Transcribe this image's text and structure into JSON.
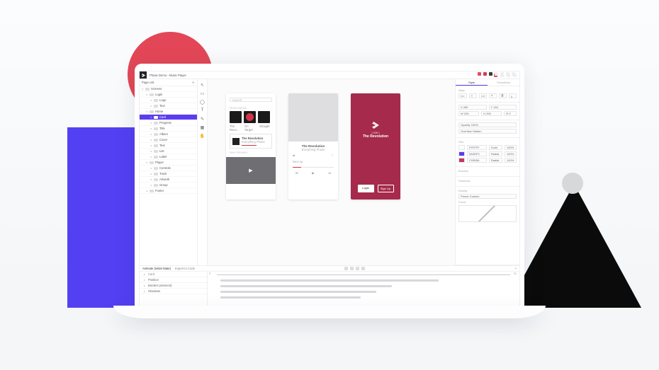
{
  "breadcrumb": {
    "project": "Phase Demo",
    "file": "Music Player"
  },
  "layers": {
    "header": "Page List",
    "items": [
      {
        "name": "Screens",
        "depth": 0,
        "selected": false
      },
      {
        "name": "Login",
        "depth": 1,
        "selected": false
      },
      {
        "name": "Logo",
        "depth": 2,
        "selected": false
      },
      {
        "name": "Text",
        "depth": 2,
        "selected": false
      },
      {
        "name": "Home",
        "depth": 1,
        "selected": false
      },
      {
        "name": "Card",
        "depth": 2,
        "selected": true
      },
      {
        "name": "Progress",
        "depth": 3,
        "selected": false
      },
      {
        "name": "Title",
        "depth": 3,
        "selected": false
      },
      {
        "name": "Album",
        "depth": 2,
        "selected": false
      },
      {
        "name": "Cover",
        "depth": 3,
        "selected": false
      },
      {
        "name": "Text",
        "depth": 3,
        "selected": false
      },
      {
        "name": "List",
        "depth": 3,
        "selected": false
      },
      {
        "name": "Label",
        "depth": 3,
        "selected": false
      },
      {
        "name": "Player",
        "depth": 1,
        "selected": false
      },
      {
        "name": "Controls",
        "depth": 2,
        "selected": false
      },
      {
        "name": "Track",
        "depth": 2,
        "selected": false
      },
      {
        "name": "Artwork",
        "depth": 2,
        "selected": false
      },
      {
        "name": "Group",
        "depth": 2,
        "selected": false
      },
      {
        "name": "Footer",
        "depth": 1,
        "selected": false
      }
    ]
  },
  "tools": {
    "items": [
      "pointer",
      "rectangle",
      "ellipse",
      "text",
      "pen",
      "image",
      "hand"
    ]
  },
  "artboards": {
    "ab1": {
      "search_placeholder": "Search",
      "section1": "Most popular",
      "thumbs": [
        "The Revo…",
        "On Target",
        "Straight"
      ],
      "card_title": "The Revolution",
      "card_sub": "Everything Phase",
      "section2": "New releases"
    },
    "ab2": {
      "title": "The Revolution",
      "subtitle": "Everything Phase",
      "section": "Next up"
    },
    "ab3": {
      "pretitle": "Listen",
      "title": "The Revolution",
      "btn_login": "Login",
      "btn_signup": "Sign Up"
    }
  },
  "inspector": {
    "tabs": {
      "a": "Style",
      "b": "Transitions"
    },
    "align_lbl": "Align",
    "pos": {
      "x_label": "X",
      "x": "280",
      "y_label": "Y",
      "y": "164"
    },
    "size": {
      "w_label": "W",
      "w": "200",
      "h_label": "H",
      "h": "200",
      "r_label": "R",
      "r": "0"
    },
    "opacity": {
      "lbl": "Opacity",
      "val": "100%"
    },
    "overflow": {
      "lbl": "Overflow",
      "val": "Hidden"
    },
    "fills": {
      "lbl": "Fills",
      "items": [
        {
          "hex": "FFFFFF",
          "pct": "100%",
          "mode": "Solid"
        },
        {
          "hex": "5A3DF0",
          "pct": "100%",
          "mode": "Radial"
        },
        {
          "hex": "C9365A",
          "pct": "100%",
          "mode": "Radial"
        }
      ]
    },
    "borders": {
      "lbl": "Borders"
    },
    "shadows": {
      "lbl": "Shadows"
    },
    "easing": {
      "lbl": "Easing",
      "preset_lbl": "Preset",
      "preset": "Custom",
      "curve_lbl": "Curve"
    }
  },
  "timeline": {
    "tab_a": "Animate (Initial State)",
    "tab_b": "Export to Code",
    "zoom": "×",
    "rows": [
      {
        "name": "Card"
      },
      {
        "name": "Position"
      },
      {
        "name": "Borders (element)"
      },
      {
        "name": "Shadows"
      }
    ],
    "time_start": "0",
    "time_end": "5s"
  },
  "colors": {
    "accent": "#5a3df0",
    "brand_pink": "#c9365a"
  }
}
